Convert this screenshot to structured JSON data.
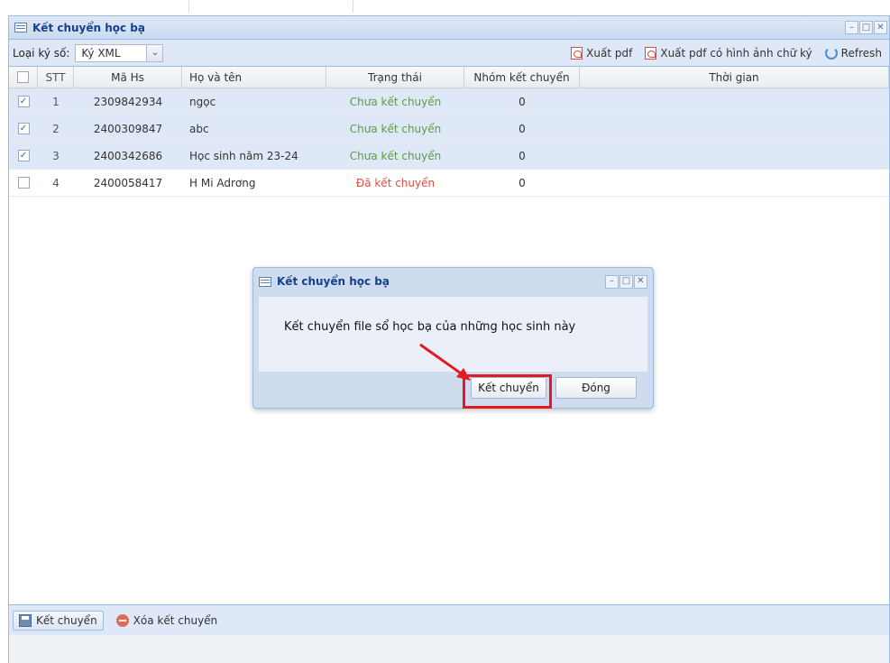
{
  "window": {
    "title": "Kết chuyển học bạ"
  },
  "toolbar": {
    "sign_type_label": "Loại ký số:",
    "sign_type_value": "Ký XML",
    "export_pdf": "Xuất pdf",
    "export_pdf_signature": "Xuất pdf có hình ảnh chữ ký",
    "refresh": "Refresh"
  },
  "grid": {
    "columns": [
      "STT",
      "Mã Hs",
      "Họ và tên",
      "Trạng thái",
      "Nhóm kết chuyển",
      "Thời gian"
    ],
    "rows": [
      {
        "stt": "1",
        "ma_hs": "2309842934",
        "name": "ngọc",
        "status": "Chưa kết chuyển",
        "group": "0",
        "time": "",
        "checked": true
      },
      {
        "stt": "2",
        "ma_hs": "2400309847",
        "name": "abc",
        "status": "Chưa kết chuyển",
        "group": "0",
        "time": "",
        "checked": true
      },
      {
        "stt": "3",
        "ma_hs": "2400342686",
        "name": "Học sinh năm 23-24",
        "status": "Chưa kết chuyển",
        "group": "0",
        "time": "",
        "checked": true
      },
      {
        "stt": "4",
        "ma_hs": "2400058417",
        "name": "H Mi Adrơng",
        "status": "Đã kết chuyển",
        "group": "0",
        "time": "",
        "checked": false
      }
    ]
  },
  "bottombar": {
    "transfer": "Kết chuyển",
    "delete_transfer": "Xóa kết chuyển"
  },
  "dialog": {
    "title": "Kết chuyển học bạ",
    "message": "Kết chuyển file sổ học bạ của những học sinh này",
    "confirm": "Kết chuyển",
    "close": "Đóng"
  },
  "colors": {
    "pending": "#5a9e3f",
    "done": "#e24b3b",
    "highlight": "#e11b22",
    "header_blue": "#15428b"
  }
}
